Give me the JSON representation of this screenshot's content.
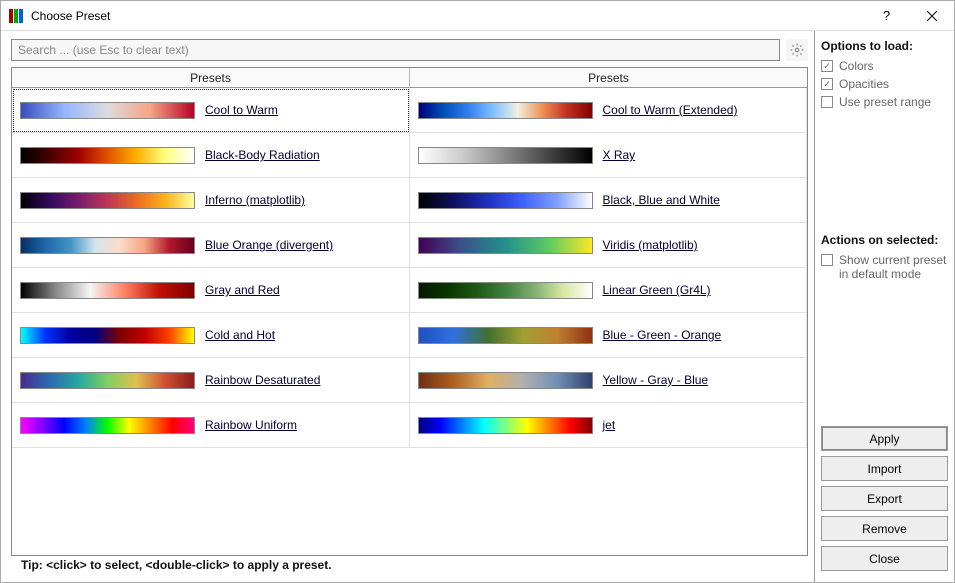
{
  "title": "Choose Preset",
  "search": {
    "placeholder": "Search ... (use Esc to clear text)"
  },
  "header_label": "Presets",
  "presets_left": [
    {
      "name": "Cool to Warm",
      "cls": "g-coolwarm",
      "sel": true
    },
    {
      "name": "Black-Body Radiation",
      "cls": "g-blackbody"
    },
    {
      "name": "Inferno (matplotlib)",
      "cls": "g-inferno"
    },
    {
      "name": "Blue Orange (divergent)",
      "cls": "g-blueorange"
    },
    {
      "name": "Gray and Red",
      "cls": "g-grayred"
    },
    {
      "name": "Cold and Hot",
      "cls": "g-coldhot"
    },
    {
      "name": "Rainbow Desaturated",
      "cls": "g-rainbowdesat"
    },
    {
      "name": "Rainbow Uniform",
      "cls": "g-rainbowuni"
    }
  ],
  "presets_right": [
    {
      "name": "Cool to Warm (Extended)",
      "cls": "g-coolwarm-ext"
    },
    {
      "name": "X Ray",
      "cls": "g-xray"
    },
    {
      "name": "Black, Blue and White",
      "cls": "g-bbw"
    },
    {
      "name": "Viridis (matplotlib)",
      "cls": "g-viridis"
    },
    {
      "name": "Linear Green (Gr4L)",
      "cls": "g-lingreen"
    },
    {
      "name": "Blue - Green - Orange",
      "cls": "g-bgo"
    },
    {
      "name": "Yellow - Gray - Blue",
      "cls": "g-ygb"
    },
    {
      "name": "jet",
      "cls": "g-jet"
    }
  ],
  "tip": "Tip: <click> to select, <double-click> to apply a preset.",
  "options": {
    "title": "Options to load:",
    "colors": {
      "label": "Colors",
      "checked": true
    },
    "opacities": {
      "label": "Opacities",
      "checked": true
    },
    "range": {
      "label": "Use preset range",
      "checked": false
    }
  },
  "actions": {
    "title": "Actions on selected:",
    "showdefault": {
      "label": "Show current preset in default mode",
      "checked": false
    }
  },
  "buttons": {
    "apply": "Apply",
    "import": "Import",
    "export": "Export",
    "remove": "Remove",
    "close": "Close"
  }
}
